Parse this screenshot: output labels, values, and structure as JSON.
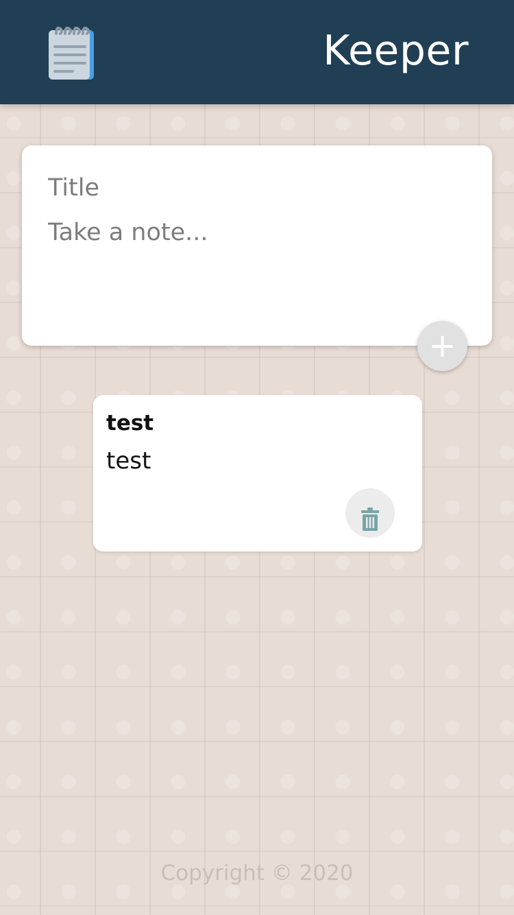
{
  "header": {
    "app_title": "Keeper",
    "logo_icon": "notepad-icon",
    "background_color": "#213f54"
  },
  "compose": {
    "title_placeholder": "Title",
    "content_placeholder": "Take a note...",
    "add_label": "+"
  },
  "notes": [
    {
      "title": "test",
      "content": "test",
      "delete_icon": "trash-icon"
    }
  ],
  "footer": {
    "copyright": "Copyright © 2020"
  },
  "colors": {
    "header": "#213f54",
    "page_background": "#e8ddd5",
    "accent_icon": "#78a4a8"
  }
}
